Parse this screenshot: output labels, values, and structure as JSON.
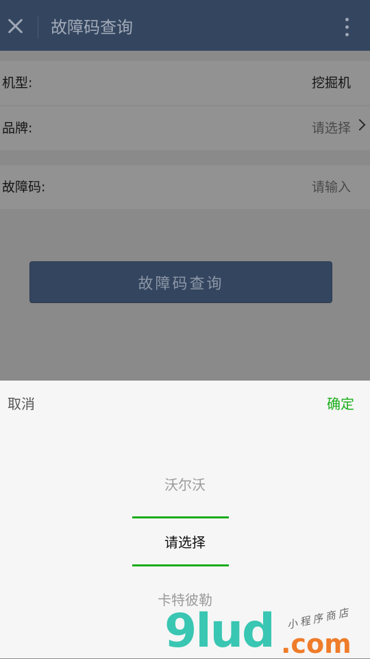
{
  "header": {
    "title": "故障码查询"
  },
  "form": {
    "model_label": "机型:",
    "model_value": "挖掘机",
    "brand_label": "品牌:",
    "brand_placeholder": "请选择",
    "code_label": "故障码:",
    "code_placeholder": "请输入",
    "query_button": "故障码查询"
  },
  "picker": {
    "cancel_label": "取消",
    "confirm_label": "确定",
    "options": [
      "沃尔沃",
      "请选择",
      "卡特彼勒"
    ],
    "selected_index": 1,
    "accent_color": "#1aad19"
  },
  "watermark": {
    "brand": "9lud",
    "tld": ".com",
    "slogan": "小程序商店"
  },
  "colors": {
    "topbar": "#34455f",
    "overlay_dim": "#8a8a8a"
  }
}
